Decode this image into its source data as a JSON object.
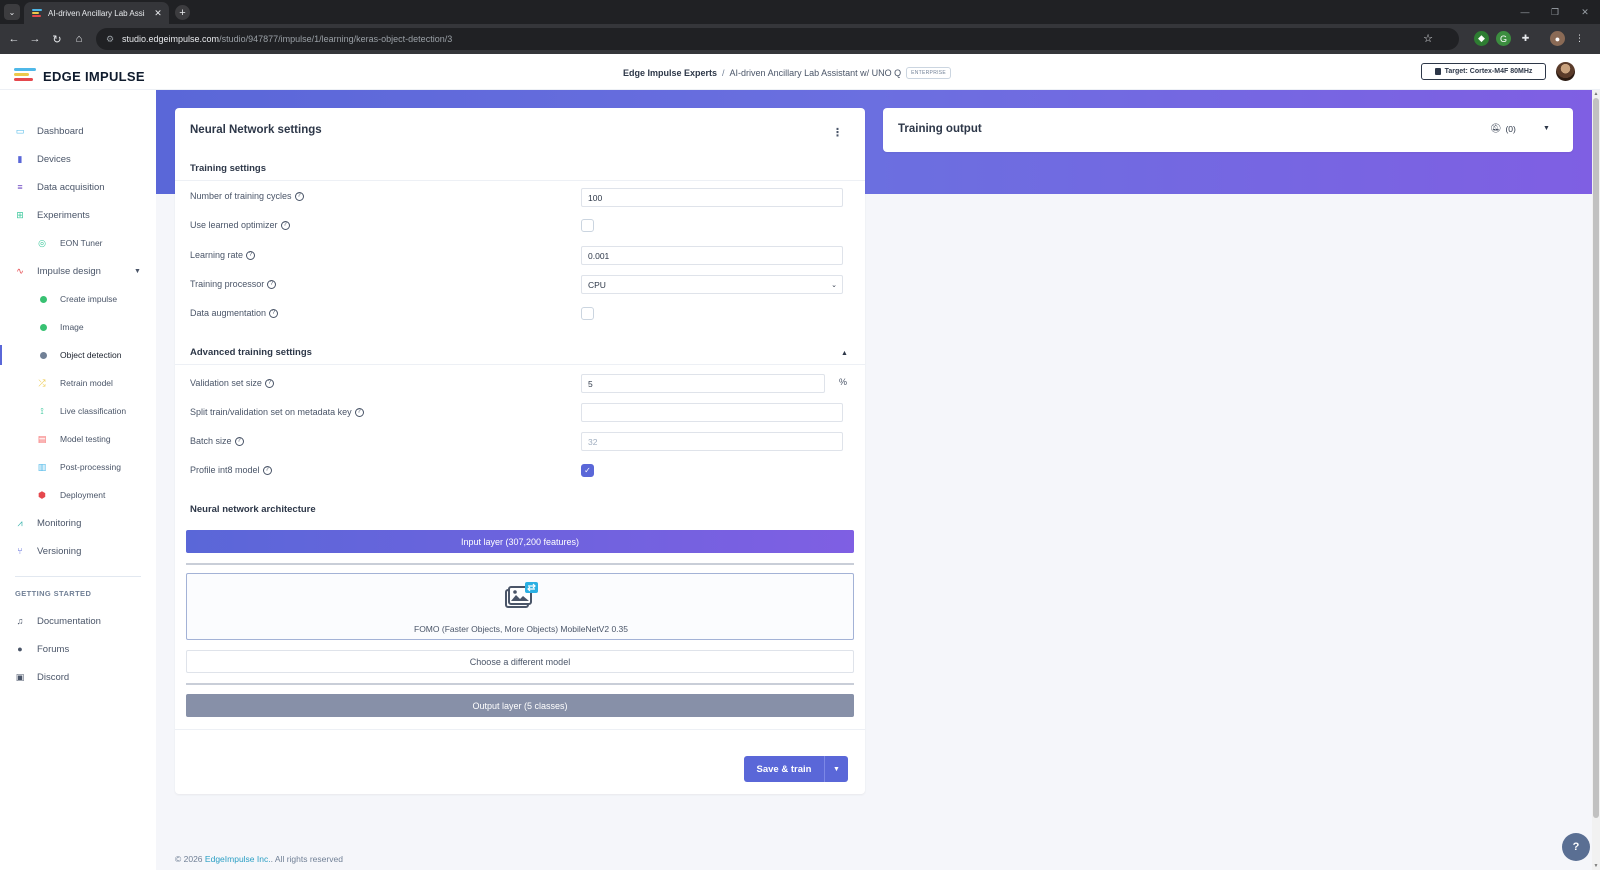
{
  "browser": {
    "tab_title": "AI-driven Ancillary Lab Assistant",
    "url_host": "studio.edgeimpulse.com",
    "url_path": "/studio/947877/impulse/1/learning/keras-object-detection/3"
  },
  "header": {
    "logo_text": "EDGE IMPULSE",
    "breadcrumb_org": "Edge Impulse Experts",
    "breadcrumb_sep": "/",
    "breadcrumb_project": "AI-driven Ancillary Lab Assistant w/ UNO Q",
    "enterprise_badge": "ENTERPRISE",
    "target_label": "Target: Cortex-M4F 80MHz"
  },
  "sidebar": {
    "items": [
      {
        "label": "Dashboard",
        "icon": "monitor-icon",
        "color": "#4fb8e8"
      },
      {
        "label": "Devices",
        "icon": "device-icon",
        "color": "#5a67d8"
      },
      {
        "label": "Data acquisition",
        "icon": "database-icon",
        "color": "#6b46c1"
      },
      {
        "label": "Experiments",
        "icon": "table-icon",
        "color": "#38c79a"
      },
      {
        "label": "EON Tuner",
        "icon": "tuner-icon",
        "color": "#38c79a"
      },
      {
        "label": "Impulse design",
        "icon": "pulse-icon",
        "color": "#e5484d"
      },
      {
        "label": "Create impulse",
        "icon": "status-dot",
        "color": "#38c172"
      },
      {
        "label": "Image",
        "icon": "status-dot",
        "color": "#38c172"
      },
      {
        "label": "Object detection",
        "icon": "status-dot",
        "color": "#718096"
      },
      {
        "label": "Retrain model",
        "icon": "shuffle-icon",
        "color": "#ecc94b"
      },
      {
        "label": "Live classification",
        "icon": "live-icon",
        "color": "#38c79a"
      },
      {
        "label": "Model testing",
        "icon": "clipboard-icon",
        "color": "#f56565"
      },
      {
        "label": "Post-processing",
        "icon": "sliders-icon",
        "color": "#4fb8e8"
      },
      {
        "label": "Deployment",
        "icon": "package-icon",
        "color": "#e5484d"
      },
      {
        "label": "Monitoring",
        "icon": "monitoring-icon",
        "color": "#38b2ac"
      },
      {
        "label": "Versioning",
        "icon": "branch-icon",
        "color": "#5a67d8"
      }
    ],
    "section_title": "GETTING STARTED",
    "help_items": [
      {
        "label": "Documentation",
        "icon": "book-icon"
      },
      {
        "label": "Forums",
        "icon": "chat-icon"
      },
      {
        "label": "Discord",
        "icon": "discord-icon"
      }
    ]
  },
  "nn_settings": {
    "title": "Neural Network settings",
    "training_section": "Training settings",
    "fields": {
      "cycles_label": "Number of training cycles",
      "cycles_value": "100",
      "optimizer_label": "Use learned optimizer",
      "optimizer_checked": false,
      "lr_label": "Learning rate",
      "lr_value": "0.001",
      "processor_label": "Training processor",
      "processor_value": "CPU",
      "augmentation_label": "Data augmentation",
      "augmentation_checked": false
    },
    "advanced_section": "Advanced training settings",
    "advanced": {
      "validation_label": "Validation set size",
      "validation_value": "5",
      "validation_unit": "%",
      "split_label": "Split train/validation set on metadata key",
      "split_value": "",
      "batch_label": "Batch size",
      "batch_placeholder": "32",
      "profile_label": "Profile int8 model",
      "profile_checked": true
    },
    "architecture_section": "Neural network architecture",
    "input_layer": "Input layer (307,200 features)",
    "model_name": "FOMO (Faster Objects, More Objects) MobileNetV2 0.35",
    "choose_model": "Choose a different model",
    "output_layer": "Output layer (5 classes)",
    "save_train": "Save & train"
  },
  "training_output": {
    "title": "Training output",
    "notification_count": "(0)"
  },
  "footer": {
    "copyright": "© 2026",
    "company": "EdgeImpulse Inc.",
    "rights": "All rights reserved"
  },
  "colors": {
    "accent": "#5a67d8",
    "accent_purple": "#7f5fe3",
    "output_layer": "#8790a8"
  }
}
